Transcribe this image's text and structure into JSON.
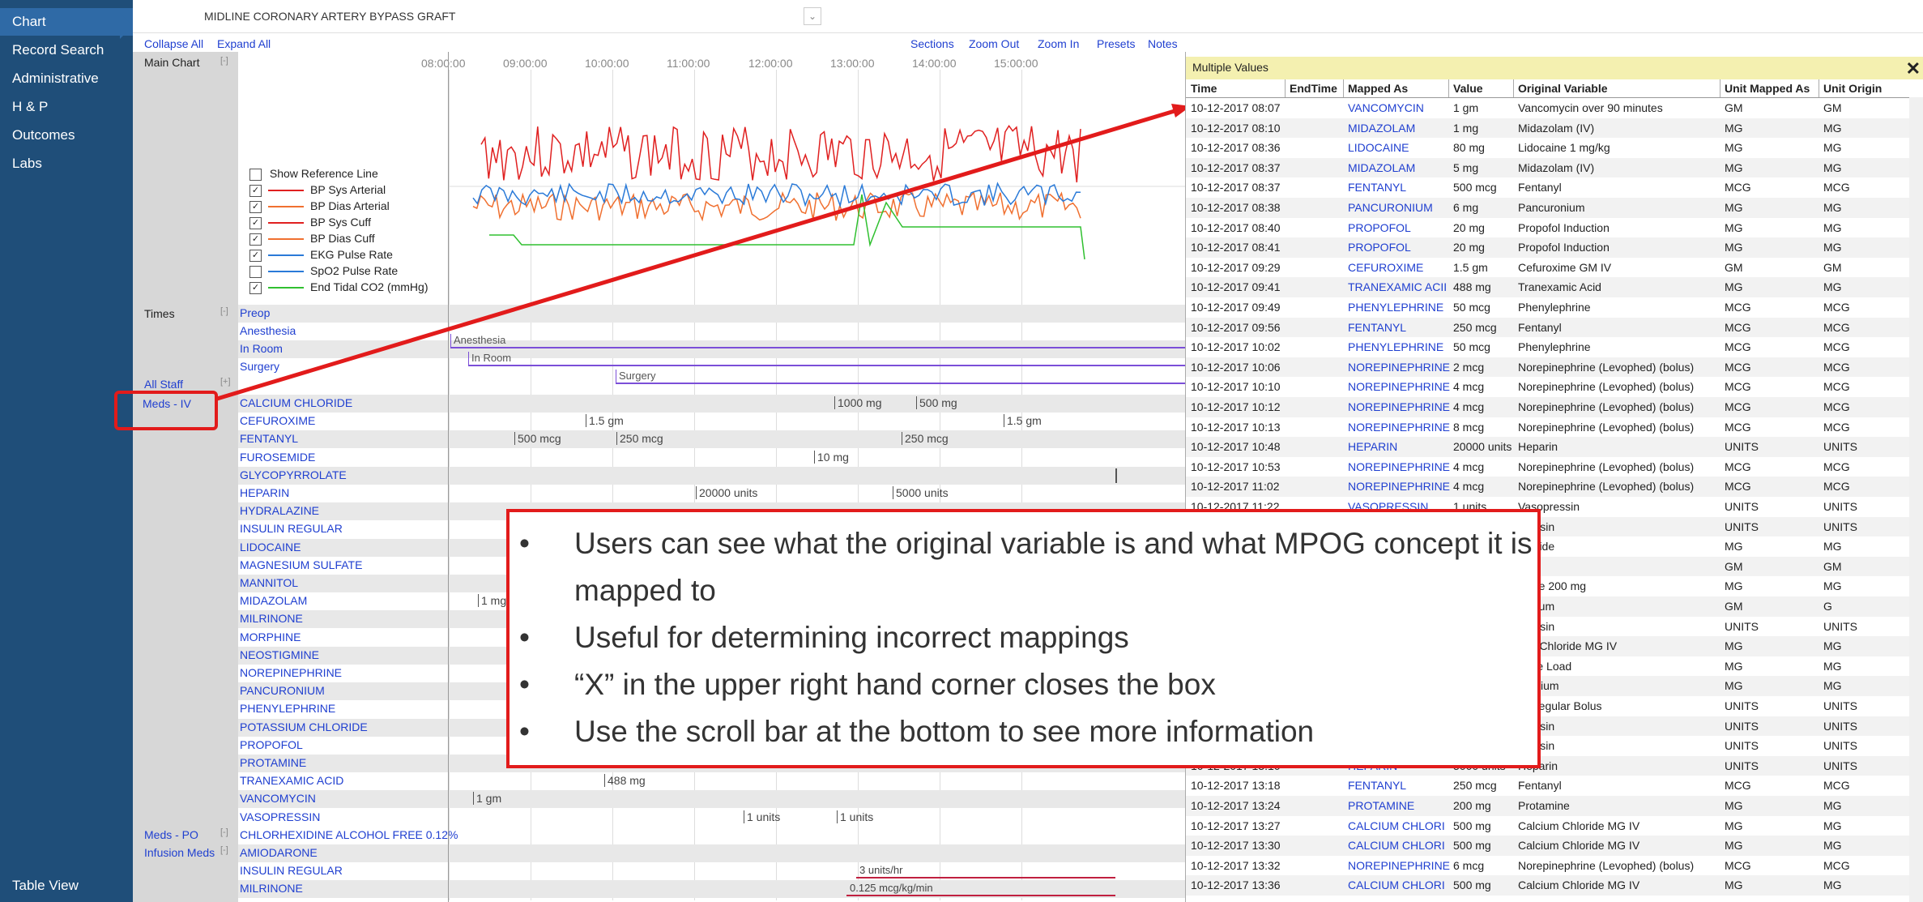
{
  "nav": {
    "items": [
      "Chart",
      "Record Search",
      "Administrative",
      "H & P",
      "Outcomes",
      "Labs"
    ],
    "table_view": "Table View"
  },
  "header": {
    "procedure": "MIDLINE CORONARY ARTERY BYPASS GRAFT",
    "dropdown": "⌄"
  },
  "toolbar": {
    "collapse_all": "Collapse All",
    "expand_all": "Expand All",
    "sections": "Sections",
    "zoom_out": "Zoom Out",
    "zoom_in": "Zoom In",
    "presets": "Presets",
    "notes": "Notes"
  },
  "chart": {
    "main_label": "Main Chart",
    "collapse": "[-]",
    "expand": "[+]",
    "times": [
      "08:00:00",
      "09:00:00",
      "10:00:00",
      "11:00:00",
      "12:00:00",
      "13:00:00",
      "14:00:00",
      "15:00:00"
    ],
    "axis": [
      "200",
      "100",
      "0"
    ],
    "legend": {
      "show_reference": "Show Reference Line",
      "items": [
        {
          "label": "BP Sys Arterial",
          "color": "#e02020",
          "checked": true
        },
        {
          "label": "BP Dias Arterial",
          "color": "#f07030",
          "checked": true
        },
        {
          "label": "BP Sys Cuff",
          "color": "#e02020",
          "checked": true
        },
        {
          "label": "BP Dias Cuff",
          "color": "#f07030",
          "checked": true
        },
        {
          "label": "EKG Pulse Rate",
          "color": "#2a7ad8",
          "checked": true
        },
        {
          "label": "SpO2 Pulse Rate",
          "color": "#2a7ad8",
          "checked": false
        },
        {
          "label": "End Tidal CO2 (mmHg)",
          "color": "#30c030",
          "checked": true
        }
      ]
    },
    "times_label": "Times",
    "times_rows": [
      "Preop",
      "Anesthesia",
      "In Room",
      "Surgery"
    ],
    "timeline_labels": [
      "Anesthesia",
      "In Room",
      "Surgery"
    ],
    "all_staff": "All Staff",
    "meds_iv_label": "Meds - IV",
    "meds_iv": [
      "CALCIUM CHLORIDE",
      "CEFUROXIME",
      "FENTANYL",
      "FUROSEMIDE",
      "GLYCOPYRROLATE",
      "HEPARIN",
      "HYDRALAZINE",
      "INSULIN REGULAR",
      "LIDOCAINE",
      "MAGNESIUM SULFATE",
      "MANNITOL",
      "MIDAZOLAM",
      "MILRINONE",
      "MORPHINE",
      "NEOSTIGMINE",
      "NOREPINEPHRINE",
      "PANCURONIUM",
      "PHENYLEPHRINE",
      "POTASSIUM CHLORIDE",
      "PROPOFOL",
      "PROTAMINE",
      "TRANEXAMIC ACID",
      "VANCOMYCIN",
      "VASOPRESSIN"
    ],
    "meds_po_label": "Meds - PO",
    "meds_po": [
      "CHLORHEXIDINE ALCOHOL FREE 0.12%"
    ],
    "infusion_label": "Infusion Meds",
    "infusions": [
      "AMIODARONE",
      "INSULIN REGULAR",
      "MILRINONE"
    ],
    "doses": {
      "cacl1": "1000 mg",
      "cacl2": "500 mg",
      "cef1": "1.5 gm",
      "cef2": "1.5 gm",
      "fen1": "500 mcg",
      "fen2": "250 mcg",
      "fen3": "250 mcg",
      "furo": "10 mg",
      "hep1": "20000 units",
      "hep2": "5000 units",
      "mid": "1 mg",
      "txa": "488 mg",
      "vanc": "1 gm",
      "vaso1": "1 units",
      "vaso2": "1 units",
      "insulin_inf": "3 units/hr",
      "milrinone_inf": "0.125 mcg/kg/min"
    }
  },
  "overlay": {
    "bullets": [
      "Users can see what the original variable is and what MPOG concept it is mapped to",
      "Useful for determining incorrect mappings",
      "“X” in the upper right hand corner closes the box",
      "Use the scroll bar at the bottom to see more information"
    ]
  },
  "multiple_values": {
    "title": "Multiple Values",
    "close": "✕",
    "columns": [
      "Time",
      "EndTime",
      "Mapped As",
      "Value",
      "Original Variable",
      "Unit Mapped As",
      "Unit Origin"
    ],
    "rows": [
      [
        "10-12-2017 08:07",
        "",
        "VANCOMYCIN",
        "1 gm",
        "Vancomycin over 90 minutes",
        "GM",
        "GM"
      ],
      [
        "10-12-2017 08:10",
        "",
        "MIDAZOLAM",
        "1 mg",
        "Midazolam (IV)",
        "MG",
        "MG"
      ],
      [
        "10-12-2017 08:36",
        "",
        "LIDOCAINE",
        "80 mg",
        "Lidocaine 1 mg/kg",
        "MG",
        "MG"
      ],
      [
        "10-12-2017 08:37",
        "",
        "MIDAZOLAM",
        "5 mg",
        "Midazolam (IV)",
        "MG",
        "MG"
      ],
      [
        "10-12-2017 08:37",
        "",
        "FENTANYL",
        "500 mcg",
        "Fentanyl",
        "MCG",
        "MCG"
      ],
      [
        "10-12-2017 08:38",
        "",
        "PANCURONIUM",
        "6 mg",
        "Pancuronium",
        "MG",
        "MG"
      ],
      [
        "10-12-2017 08:40",
        "",
        "PROPOFOL",
        "20 mg",
        "Propofol Induction",
        "MG",
        "MG"
      ],
      [
        "10-12-2017 08:41",
        "",
        "PROPOFOL",
        "20 mg",
        "Propofol Induction",
        "MG",
        "MG"
      ],
      [
        "10-12-2017 09:29",
        "",
        "CEFUROXIME",
        "1.5 gm",
        "Cefuroxime  GM IV",
        "GM",
        "GM"
      ],
      [
        "10-12-2017 09:41",
        "",
        "TRANEXAMIC ACII",
        "488 mg",
        "Tranexamic Acid",
        "MG",
        "MG"
      ],
      [
        "10-12-2017 09:49",
        "",
        "PHENYLEPHRINE",
        "50 mcg",
        "Phenylephrine",
        "MCG",
        "MCG"
      ],
      [
        "10-12-2017 09:56",
        "",
        "FENTANYL",
        "250 mcg",
        "Fentanyl",
        "MCG",
        "MCG"
      ],
      [
        "10-12-2017 10:02",
        "",
        "PHENYLEPHRINE",
        "50 mcg",
        "Phenylephrine",
        "MCG",
        "MCG"
      ],
      [
        "10-12-2017 10:06",
        "",
        "NOREPINEPHRINE",
        "2 mcg",
        "Norepinephrine (Levophed) (bolus)",
        "MCG",
        "MCG"
      ],
      [
        "10-12-2017 10:10",
        "",
        "NOREPINEPHRINE",
        "4 mcg",
        "Norepinephrine (Levophed) (bolus)",
        "MCG",
        "MCG"
      ],
      [
        "10-12-2017 10:12",
        "",
        "NOREPINEPHRINE",
        "4 mcg",
        "Norepinephrine (Levophed) (bolus)",
        "MCG",
        "MCG"
      ],
      [
        "10-12-2017 10:13",
        "",
        "NOREPINEPHRINE",
        "8 mcg",
        "Norepinephrine (Levophed) (bolus)",
        "MCG",
        "MCG"
      ],
      [
        "10-12-2017 10:48",
        "",
        "HEPARIN",
        "20000 units",
        "Heparin",
        "UNITS",
        "UNITS"
      ],
      [
        "10-12-2017 10:53",
        "",
        "NOREPINEPHRINE",
        "4 mcg",
        "Norepinephrine (Levophed) (bolus)",
        "MCG",
        "MCG"
      ],
      [
        "10-12-2017 11:02",
        "",
        "NOREPINEPHRINE",
        "4 mcg",
        "Norepinephrine (Levophed) (bolus)",
        "MCG",
        "MCG"
      ],
      [
        "10-12-2017 11:22",
        "",
        "VASOPRESSIN",
        "1 units",
        "Vasopressin",
        "UNITS",
        "UNITS"
      ],
      [
        "",
        "",
        "",
        "",
        "pressin",
        "UNITS",
        "UNITS"
      ],
      [
        "",
        "",
        "",
        "",
        "semide",
        "MG",
        "MG"
      ],
      [
        "",
        "",
        "",
        "",
        "nitol",
        "GM",
        "GM"
      ],
      [
        "",
        "",
        "",
        "",
        "caine 200 mg",
        "MG",
        "MG"
      ],
      [
        "",
        "",
        "",
        "",
        "nesium",
        "GM",
        "G"
      ],
      [
        "",
        "",
        "",
        "",
        "pressin",
        "UNITS",
        "UNITS"
      ],
      [
        "",
        "",
        "",
        "",
        "ium Chloride  MG IV",
        "MG",
        "MG"
      ],
      [
        "",
        "",
        "",
        "",
        "none Load",
        "MG",
        "MG"
      ],
      [
        "",
        "",
        "",
        "",
        "uronium",
        "MG",
        "MG"
      ],
      [
        "",
        "",
        "",
        "",
        "n, Regular Bolus",
        "UNITS",
        "UNITS"
      ],
      [
        "",
        "",
        "",
        "",
        "pressin",
        "UNITS",
        "UNITS"
      ],
      [
        "",
        "",
        "",
        "",
        "pressin",
        "UNITS",
        "UNITS"
      ],
      [
        "10-12-2017 13:10",
        "",
        "HEPARIN",
        "5000 units",
        "Heparin",
        "UNITS",
        "UNITS"
      ],
      [
        "10-12-2017 13:18",
        "",
        "FENTANYL",
        "250 mcg",
        "Fentanyl",
        "MCG",
        "MCG"
      ],
      [
        "10-12-2017 13:24",
        "",
        "PROTAMINE",
        "200 mg",
        "Protamine",
        "MG",
        "MG"
      ],
      [
        "10-12-2017 13:27",
        "",
        "CALCIUM CHLORI",
        "500 mg",
        "Calcium Chloride  MG IV",
        "MG",
        "MG"
      ],
      [
        "10-12-2017 13:30",
        "",
        "CALCIUM CHLORI",
        "500 mg",
        "Calcium Chloride  MG IV",
        "MG",
        "MG"
      ],
      [
        "10-12-2017 13:32",
        "",
        "NOREPINEPHRINE",
        "6 mcg",
        "Norepinephrine (Levophed) (bolus)",
        "MCG",
        "MCG"
      ],
      [
        "10-12-2017 13:36",
        "",
        "CALCIUM CHLORI",
        "500 mg",
        "Calcium Chloride  MG IV",
        "MG",
        "MG"
      ]
    ]
  }
}
